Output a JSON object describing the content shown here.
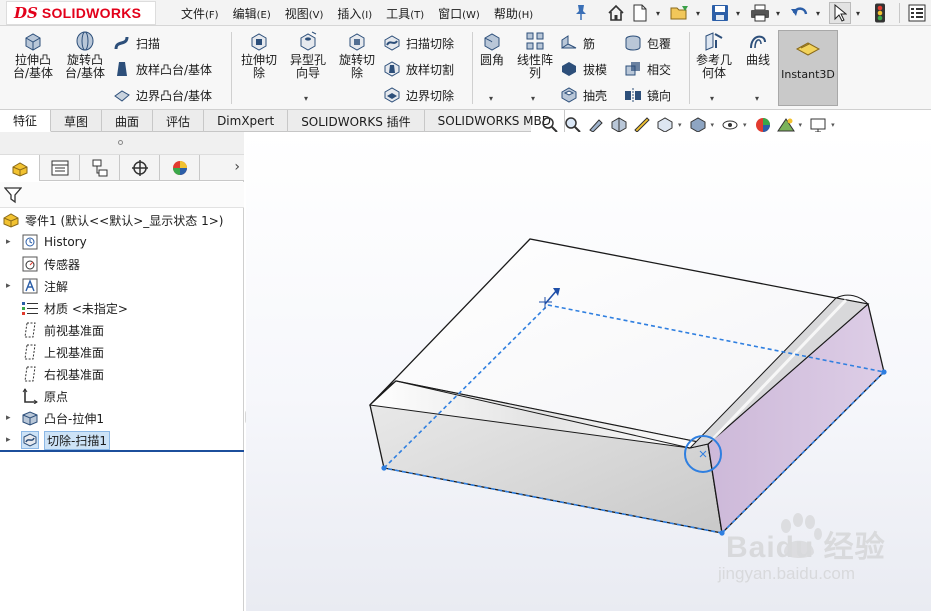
{
  "app": {
    "brand_mark": "DS",
    "brand_name": "SOLIDWORKS"
  },
  "menu": [
    {
      "label": "文件",
      "accel": "(F)"
    },
    {
      "label": "编辑",
      "accel": "(E)"
    },
    {
      "label": "视图",
      "accel": "(V)"
    },
    {
      "label": "插入",
      "accel": "(I)"
    },
    {
      "label": "工具",
      "accel": "(T)"
    },
    {
      "label": "窗口",
      "accel": "(W)"
    },
    {
      "label": "帮助",
      "accel": "(H)"
    }
  ],
  "quick_access": [
    "home-icon",
    "new-document-icon",
    "open-icon",
    "save-icon",
    "print-icon",
    "undo-icon",
    "select-icon",
    "rebuild-icon",
    "options-icon"
  ],
  "ribbon": {
    "extrude_boss": "拉伸凸\n台/基体",
    "revolve_boss": "旋转凸\n台/基体",
    "sweep": "扫描",
    "loft_boss": "放样凸台/基体",
    "boundary_boss": "边界凸台/基体",
    "extrude_cut": "拉伸切\n除",
    "hole_wizard": "异型孔\n向导",
    "revolve_cut": "旋转切\n除",
    "swept_cut": "扫描切除",
    "lofted_cut": "放样切割",
    "boundary_cut": "边界切除",
    "fillet": "圆角",
    "linear_pattern": "线性阵\n列",
    "rib": "筋",
    "draft": "拔模",
    "shell": "抽壳",
    "wrap": "包覆",
    "intersect": "相交",
    "mirror": "镜向",
    "reference_geometry": "参考几\n何体",
    "curves": "曲线",
    "instant3d": "Instant3D"
  },
  "tabs": [
    "特征",
    "草图",
    "曲面",
    "评估",
    "DimXpert",
    "SOLIDWORKS 插件",
    "SOLIDWORKS MBD"
  ],
  "active_tab": "特征",
  "tree": {
    "root": "零件1  (默认<<默认>_显示状态 1>)",
    "items": [
      {
        "label": "History",
        "icon": "history-icon",
        "expandable": true
      },
      {
        "label": "传感器",
        "icon": "sensor-icon",
        "expandable": false
      },
      {
        "label": "注解",
        "icon": "annotation-icon",
        "expandable": true
      },
      {
        "label": "材质 <未指定>",
        "icon": "material-icon",
        "expandable": false
      },
      {
        "label": "前视基准面",
        "icon": "plane-icon",
        "expandable": false
      },
      {
        "label": "上视基准面",
        "icon": "plane-icon",
        "expandable": false
      },
      {
        "label": "右视基准面",
        "icon": "plane-icon",
        "expandable": false
      },
      {
        "label": "原点",
        "icon": "origin-icon",
        "expandable": false
      },
      {
        "label": "凸台-拉伸1",
        "icon": "extrude-feature-icon",
        "expandable": true
      },
      {
        "label": "切除-扫描1",
        "icon": "swept-cut-feature-icon",
        "expandable": true,
        "selected": true
      }
    ]
  },
  "colors": {
    "brand": "#e2001a",
    "selection": "#cde3f7",
    "sketch_blue": "#2f7fe0",
    "face_shade": "#d6c3df"
  },
  "watermark": {
    "line1": "Baidu 经验",
    "line2": "jingyan.baidu.com"
  }
}
